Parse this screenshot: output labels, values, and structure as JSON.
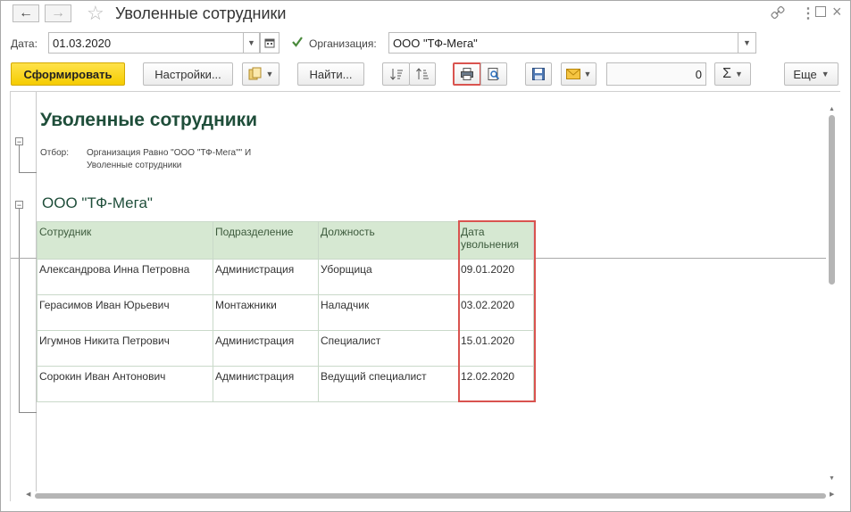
{
  "window": {
    "title": "Уволенные сотрудники"
  },
  "params": {
    "date_label": "Дата:",
    "date_value": "01.03.2020",
    "org_label": "Организация:",
    "org_value": "ООО \"ТФ-Мега\""
  },
  "toolbar": {
    "generate": "Сформировать",
    "settings": "Настройки...",
    "find": "Найти...",
    "sum_value": "0",
    "more": "Еще"
  },
  "report": {
    "title": "Уволенные сотрудники",
    "filter_label": "Отбор:",
    "filter_line1": "Организация Равно \"ООО \"ТФ-Мега\"\" И",
    "filter_line2": "Уволенные сотрудники",
    "group": "ООО \"ТФ-Мега\"",
    "columns": [
      "Сотрудник",
      "Подразделение",
      "Должность",
      "Дата увольнения"
    ],
    "col_date_line1": "Дата",
    "col_date_line2": "увольнения",
    "rows": [
      [
        "Александрова Инна Петровна",
        "Администрация",
        "Уборщица",
        "09.01.2020"
      ],
      [
        "Герасимов Иван Юрьевич",
        "Монтажники",
        "Наладчик",
        "03.02.2020"
      ],
      [
        "Игумнов Никита Петрович",
        "Администрация",
        "Специалист",
        "15.01.2020"
      ],
      [
        "Сорокин Иван Антонович",
        "Администрация",
        "Ведущий специалист",
        "12.02.2020"
      ]
    ]
  },
  "colors": {
    "primary_button": "#f5cc00",
    "header_fill": "#d6e8d2",
    "title_color": "#1f4e3a",
    "highlight": "#d9534f"
  },
  "icons": {
    "back": "arrow-left-icon",
    "forward": "arrow-right-icon",
    "favorite": "star-icon",
    "link": "link-icon",
    "menu": "more-vertical-icon",
    "maximize": "maximize-icon",
    "close": "close-icon",
    "calendar": "calendar-icon",
    "variants": "report-variants-icon",
    "sort_asc": "sort-ascending-icon",
    "sort_desc": "sort-descending-icon",
    "print": "printer-icon",
    "preview": "print-preview-icon",
    "save": "save-icon",
    "mail": "envelope-icon",
    "sum": "sigma-icon"
  }
}
